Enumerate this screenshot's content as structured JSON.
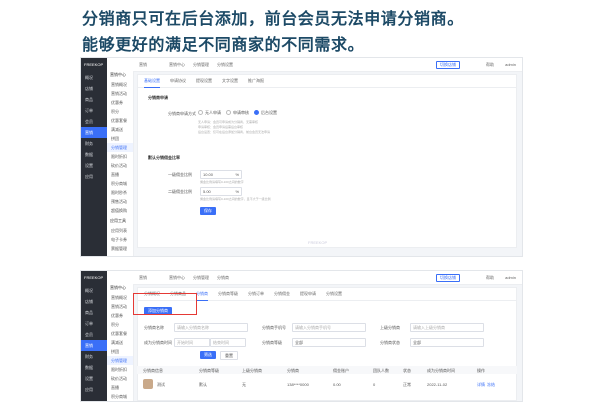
{
  "headline": {
    "line1": "分销商只可在后台添加，前台会员无法申请分销商。",
    "line2": "能够更好的满足不同商家的不同需求。"
  },
  "app": {
    "logo": "FREEKOP",
    "sidebar": [
      "概况",
      "店铺",
      "商品",
      "订单",
      "会员",
      "营销",
      "财务",
      "数据",
      "设置",
      "应用"
    ],
    "active_index": 5,
    "top_crumb": "营销",
    "top_tab_button": "切换店铺",
    "help": "帮助",
    "user": "admin"
  },
  "shot1": {
    "top_tabs": [
      "营销中心",
      "分销管理",
      "分销设置"
    ],
    "submenu_group": "营销中心",
    "submenu": [
      "营销概况",
      "营销活动",
      "优惠券",
      "积分",
      "优惠套餐",
      "满减送",
      "拼团",
      "分销管理",
      "限时折扣",
      "砍价活动",
      "直播",
      "积分商城",
      "限时秒杀",
      "预售活动",
      "超值换购"
    ],
    "submenu_active": 7,
    "submenu_group2": "应用工具",
    "submenu2": [
      "应用列表",
      "电子卡券",
      "票据管理"
    ],
    "panel_tabs": [
      "基础设置",
      "申请协议",
      "提现设置",
      "文字设置",
      "推广海报"
    ],
    "section1": "分销商申请",
    "apply_label": "分销商申请方式",
    "radios": [
      "无人申请",
      "申请审核",
      "后台设置"
    ],
    "radio_selected": 2,
    "notes": [
      "无人申请：会员可申请成为分销商，无需审核",
      "申请审核：会员申请后需后台审核",
      "后台设置：仅可在后台添加分销商，前台会员无法申请"
    ],
    "section2": "默认分销佣金比率",
    "level1_label": "一级佣金比例",
    "level1_value": "10.00",
    "level2_label": "二级佣金比例",
    "level2_value": "5.00",
    "percent": "%",
    "rate_notes": [
      "佣金比例请填写0-100之间的数字",
      "佣金比例请填写0-100之间的数字，且不大于一级比例"
    ],
    "save": "保存",
    "watermark": "FREEKOP"
  },
  "shot2": {
    "top_tabs": [
      "营销中心",
      "分销管理",
      "分销商"
    ],
    "submenu_group": "营销中心",
    "submenu": [
      "营销概况",
      "营销活动",
      "优惠券",
      "积分",
      "优惠套餐",
      "满减送",
      "拼团",
      "分销管理",
      "限时折扣",
      "砍价活动",
      "直播",
      "积分商城"
    ],
    "submenu_active": 7,
    "panel_tabs": [
      "分销概况",
      "分销商品",
      "分销商",
      "分销商等级",
      "分销订单",
      "分销佣金",
      "提现申请",
      "分销设置"
    ],
    "panel_tab_active": 2,
    "add_button": "添加分销商",
    "filters": [
      {
        "label": "分销商名称",
        "placeholder": "请输入分销商名称"
      },
      {
        "label": "分销商手机号",
        "placeholder": "请输入分销商手机号"
      },
      {
        "label": "上级分销商",
        "placeholder": "请输入上级分销商"
      }
    ],
    "filters2": [
      {
        "label": "成为分销商时间",
        "start": "开始时间",
        "end": "结束时间"
      },
      {
        "label": "分销商等级",
        "value": "全部"
      },
      {
        "label": "分销商状态",
        "value": "全部"
      }
    ],
    "search": "筛选",
    "reset": "重置",
    "columns": [
      "分销商信息",
      "分销商等级",
      "上级分销商",
      "分销商",
      "佣金账户",
      "团队人数",
      "状态",
      "成为分销商时间",
      "操作"
    ],
    "row": {
      "name": "测试",
      "level": "默认",
      "parent": "无",
      "phone": "138****0000",
      "commission": "0.00",
      "team": "0",
      "status": "正常",
      "date": "2022-11-02",
      "ops": [
        "详情",
        "冻结"
      ]
    }
  }
}
